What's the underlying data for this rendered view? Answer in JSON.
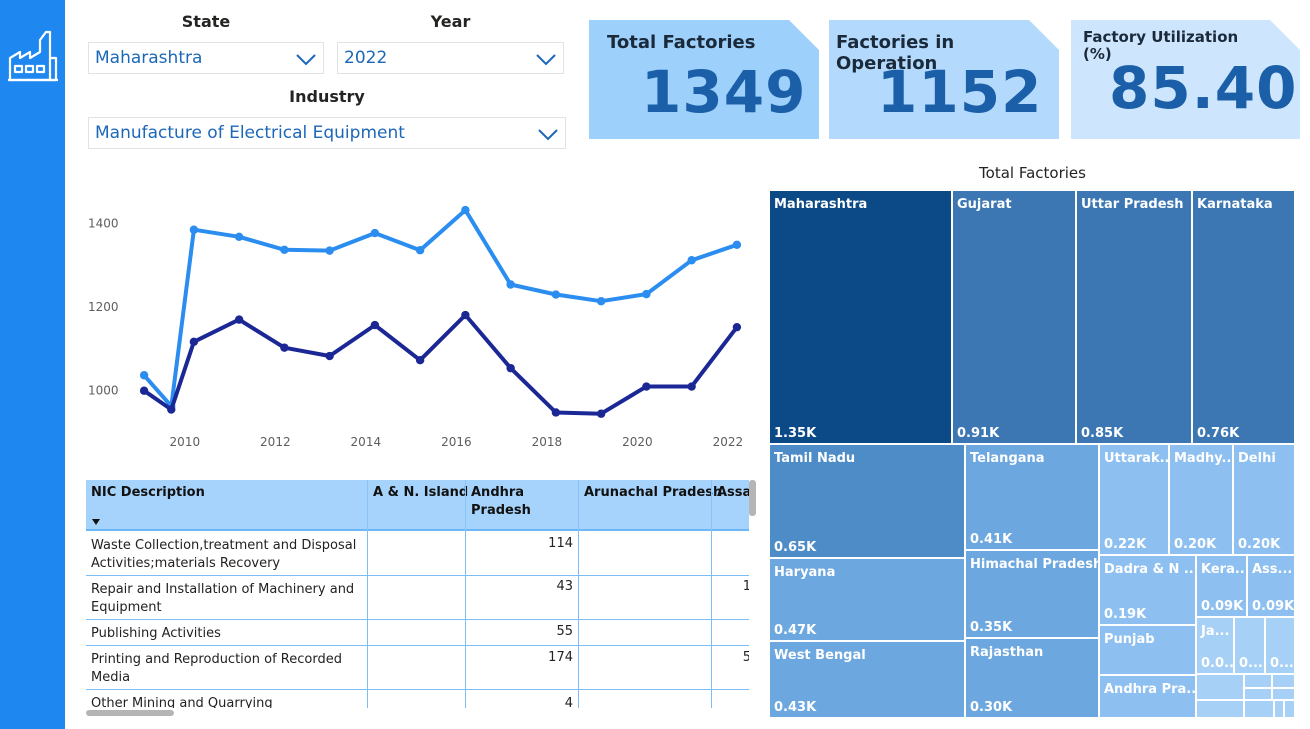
{
  "filters": {
    "state_label": "State",
    "state_value": "Maharashtra",
    "year_label": "Year",
    "year_value": "2022",
    "industry_label": "Industry",
    "industry_value": "Manufacture of Electrical Equipment"
  },
  "kpis": {
    "total_factories": {
      "title": "Total Factories",
      "value": "1349"
    },
    "factories_in_operation": {
      "title": "Factories in Operation",
      "value": "1152"
    },
    "factory_utilization": {
      "title_line1": "Factory Utilization",
      "title_line2": "(%)",
      "value": "85.40"
    }
  },
  "chart_data": {
    "type": "line",
    "x": [
      2009.1,
      2009.7,
      2010.2,
      2011.2,
      2012.2,
      2013.2,
      2014.2,
      2015.2,
      2016.2,
      2017.2,
      2018.2,
      2019.2,
      2020.2,
      2021.2,
      2022.2
    ],
    "x_ticks": [
      "2010",
      "2012",
      "2014",
      "2016",
      "2018",
      "2020",
      "2022"
    ],
    "x_tick_values": [
      2010,
      2012,
      2014,
      2016,
      2018,
      2020,
      2022
    ],
    "y_ticks": [
      "1000",
      "1200",
      "1400"
    ],
    "y_tick_values": [
      1000,
      1200,
      1400
    ],
    "ylim": [
      930,
      1480
    ],
    "xlim": [
      2008.7,
      2022.6
    ],
    "series": [
      {
        "values": [
          1037,
          963,
          1385,
          1368,
          1337,
          1335,
          1377,
          1336,
          1432,
          1254,
          1230,
          1214,
          1231,
          1312,
          1349
        ],
        "color": "#2b8df0"
      },
      {
        "values": [
          1000,
          955,
          1117,
          1170,
          1103,
          1083,
          1157,
          1073,
          1181,
          1054,
          948,
          945,
          1010,
          1010,
          1152
        ],
        "color": "#1a2794"
      }
    ],
    "grid": false
  },
  "table": {
    "headers": [
      "NIC Description",
      "A & N. Island",
      "Andhra Pradesh",
      "Arunachal Pradesh",
      "Assam"
    ],
    "header_display": {
      "andhra_line1": "Andhra",
      "andhra_line2": "Pradesh",
      "assam_short": "Assa"
    },
    "rows": [
      {
        "desc_line1": "Waste Collection,treatment and Disposal",
        "desc_line2": "Activities;materials Recovery",
        "andhra": "114"
      },
      {
        "desc_line1": "Repair and Installation of Machinery and",
        "desc_line2": "Equipment",
        "andhra": "43",
        "assam": "1"
      },
      {
        "desc_line1": "Publishing Activities",
        "desc_line2": "",
        "andhra": "55"
      },
      {
        "desc_line1": "Printing and Reproduction of Recorded",
        "desc_line2": "Media",
        "andhra": "174",
        "assam": "5"
      },
      {
        "desc_line1": "Other Mining and Quarrying",
        "desc_line2": "",
        "andhra": "4"
      }
    ]
  },
  "treemap": {
    "title": "Total Factories",
    "tiles": [
      {
        "name": "Maharashtra",
        "value": "1.35K"
      },
      {
        "name": "Gujarat",
        "value": "0.91K"
      },
      {
        "name": "Uttar Pradesh",
        "value": "0.85K"
      },
      {
        "name": "Karnataka",
        "value": "0.76K"
      },
      {
        "name": "Tamil Nadu",
        "value": "0.65K"
      },
      {
        "name": "Telangana",
        "value": "0.41K"
      },
      {
        "name": "Uttarak...",
        "value": "0.22K"
      },
      {
        "name": "Madhy...",
        "value": "0.20K"
      },
      {
        "name": "Delhi",
        "value": "0.20K"
      },
      {
        "name": "Haryana",
        "value": "0.47K"
      },
      {
        "name": "Himachal Pradesh",
        "value": "0.35K"
      },
      {
        "name": "Dadra & N ...",
        "value": "0.19K"
      },
      {
        "name": "Kera...",
        "value": "0.09K"
      },
      {
        "name": "Ass...",
        "value": "0.09K"
      },
      {
        "name": "West Bengal",
        "value": "0.43K"
      },
      {
        "name": "Rajasthan",
        "value": "0.30K"
      },
      {
        "name": "Punjab",
        "value": ""
      },
      {
        "name": "Ja...",
        "value": "0.0..."
      },
      {
        "name": "",
        "value": "0...."
      },
      {
        "name": "",
        "value": "0...."
      },
      {
        "name": "Andhra Pra...",
        "value": ""
      }
    ],
    "colors": {
      "dark": "#0b4a86",
      "mid1": "#3c77b3",
      "mid2": "#4e8cc8",
      "mid3": "#6ca7df",
      "light": "#8dbff0",
      "lighter": "#a7d0f6"
    }
  },
  "icons": {
    "logo": "factory-icon",
    "dropdown": "chevron-down-icon",
    "sort": "sort-desc-icon"
  }
}
